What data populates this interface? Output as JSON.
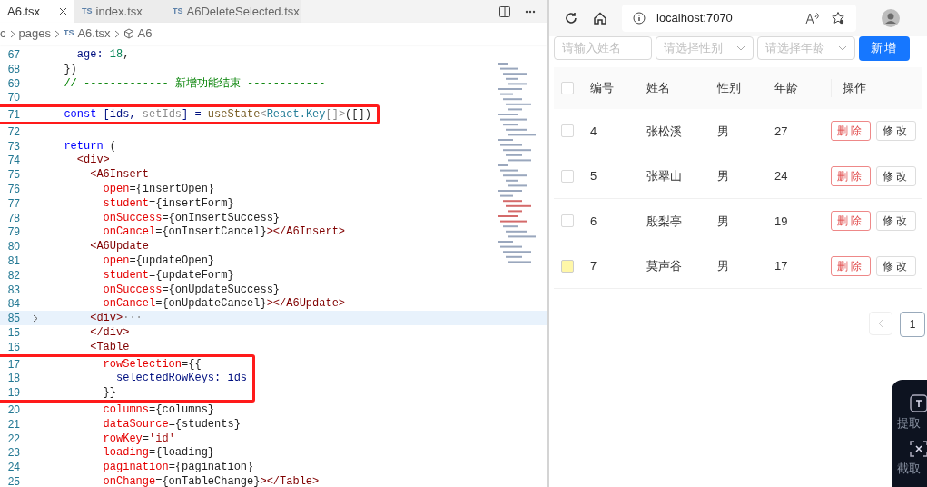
{
  "editor": {
    "tabs": [
      {
        "label": "A6.tsx",
        "selected": true
      },
      {
        "badge": "TS",
        "label": "index.tsx",
        "selected": false
      },
      {
        "badge": "TS",
        "label": "A6DeleteSelected.tsx",
        "selected": false
      }
    ],
    "breadcrumb": [
      {
        "kind": "text",
        "text": "c"
      },
      {
        "kind": "text",
        "text": "pages"
      },
      {
        "kind": "file",
        "badge": "TS",
        "text": "A6.tsx"
      },
      {
        "kind": "symbol",
        "text": "A6"
      }
    ],
    "lines": [
      {
        "num": "67",
        "boxed": false,
        "current": false,
        "folded": false,
        "tokens": [
          {
            "kind": "var",
            "text": "    age: "
          },
          {
            "kind": "num",
            "text": "18"
          },
          {
            "kind": "plain",
            "text": ","
          }
        ]
      },
      {
        "num": "68",
        "boxed": false,
        "current": false,
        "folded": false,
        "tokens": [
          {
            "kind": "plain",
            "text": "  })"
          }
        ]
      },
      {
        "num": "69",
        "boxed": false,
        "current": false,
        "folded": false,
        "tokens": [
          {
            "kind": "comment",
            "text": "  // ------------- 新增功能结束 ------------"
          }
        ]
      },
      {
        "num": "70",
        "boxed": false,
        "current": false,
        "folded": false
      },
      {
        "num": "71",
        "boxed": true,
        "current": false,
        "folded": false,
        "tokens": [
          {
            "kind": "kw",
            "text": "  const "
          },
          {
            "kind": "var",
            "text": "[ids, "
          },
          {
            "kind": "fade",
            "text": "setIds"
          },
          {
            "kind": "var",
            "text": "] = "
          },
          {
            "kind": "fn",
            "text": "useState"
          },
          {
            "kind": "fade",
            "text": "<"
          },
          {
            "kind": "type",
            "text": "React.Key"
          },
          {
            "kind": "fade",
            "text": "[]>"
          },
          {
            "kind": "plain",
            "text": "([])"
          }
        ]
      },
      {
        "num": "72",
        "boxed": false,
        "current": false,
        "folded": false
      },
      {
        "num": "73",
        "boxed": false,
        "current": false,
        "folded": false,
        "tokens": [
          {
            "kind": "kw",
            "text": "  return "
          },
          {
            "kind": "plain",
            "text": "("
          }
        ]
      },
      {
        "num": "74",
        "boxed": false,
        "current": false,
        "folded": false,
        "tokens": [
          {
            "kind": "tag",
            "text": "    <div>"
          }
        ]
      },
      {
        "num": "75",
        "boxed": false,
        "current": false,
        "folded": false,
        "tokens": [
          {
            "kind": "tag",
            "text": "      <A6Insert"
          }
        ]
      },
      {
        "num": "76",
        "boxed": false,
        "current": false,
        "folded": false,
        "tokens": [
          {
            "kind": "attr",
            "text": "        open"
          },
          {
            "kind": "plain",
            "text": "={insertOpen}"
          }
        ]
      },
      {
        "num": "77",
        "boxed": false,
        "current": false,
        "folded": false,
        "tokens": [
          {
            "kind": "attr",
            "text": "        student"
          },
          {
            "kind": "plain",
            "text": "={insertForm}"
          }
        ]
      },
      {
        "num": "78",
        "boxed": false,
        "current": false,
        "folded": false,
        "tokens": [
          {
            "kind": "attr",
            "text": "        onSuccess"
          },
          {
            "kind": "plain",
            "text": "={onInsertSuccess}"
          }
        ]
      },
      {
        "num": "79",
        "boxed": false,
        "current": false,
        "folded": false,
        "tokens": [
          {
            "kind": "attr",
            "text": "        onCancel"
          },
          {
            "kind": "plain",
            "text": "={onInsertCancel}"
          },
          {
            "kind": "tag",
            "text": "></A6Insert>"
          }
        ]
      },
      {
        "num": "80",
        "boxed": false,
        "current": false,
        "folded": false,
        "tokens": [
          {
            "kind": "tag",
            "text": "      <A6Update"
          }
        ]
      },
      {
        "num": "81",
        "boxed": false,
        "current": false,
        "folded": false,
        "tokens": [
          {
            "kind": "attr",
            "text": "        open"
          },
          {
            "kind": "plain",
            "text": "={updateOpen}"
          }
        ]
      },
      {
        "num": "82",
        "boxed": false,
        "current": false,
        "folded": false,
        "tokens": [
          {
            "kind": "attr",
            "text": "        student"
          },
          {
            "kind": "plain",
            "text": "={updateForm}"
          }
        ]
      },
      {
        "num": "83",
        "boxed": false,
        "current": false,
        "folded": false,
        "tokens": [
          {
            "kind": "attr",
            "text": "        onSuccess"
          },
          {
            "kind": "plain",
            "text": "={onUpdateSuccess}"
          }
        ]
      },
      {
        "num": "84",
        "boxed": false,
        "current": false,
        "folded": false,
        "tokens": [
          {
            "kind": "attr",
            "text": "        onCancel"
          },
          {
            "kind": "plain",
            "text": "={onUpdateCancel}"
          },
          {
            "kind": "tag",
            "text": "></A6Update>"
          }
        ]
      },
      {
        "num": "85",
        "boxed": false,
        "current": true,
        "folded": true,
        "tokens": [
          {
            "kind": "tag",
            "text": "      <div>"
          },
          {
            "kind": "fade",
            "text": "···"
          }
        ]
      },
      {
        "num": "15",
        "boxed": false,
        "current": false,
        "folded": false,
        "tokens": [
          {
            "kind": "tag",
            "text": "      </div>"
          }
        ]
      },
      {
        "num": "16",
        "boxed": false,
        "current": false,
        "folded": false,
        "tokens": [
          {
            "kind": "tag",
            "text": "      <Table"
          }
        ]
      },
      {
        "num": "17",
        "boxed": true,
        "current": false,
        "folded": false,
        "tokens": [
          {
            "kind": "attr",
            "text": "        rowSelection"
          },
          {
            "kind": "plain",
            "text": "={{"
          }
        ]
      },
      {
        "num": "18",
        "boxed": true,
        "current": false,
        "folded": false,
        "tokens": [
          {
            "kind": "var",
            "text": "          selectedRowKeys: ids"
          }
        ]
      },
      {
        "num": "19",
        "boxed": true,
        "current": false,
        "folded": false,
        "tokens": [
          {
            "kind": "plain",
            "text": "        }}"
          }
        ]
      },
      {
        "num": "20",
        "boxed": false,
        "current": false,
        "folded": false,
        "tokens": [
          {
            "kind": "attr",
            "text": "        columns"
          },
          {
            "kind": "plain",
            "text": "={columns}"
          }
        ]
      },
      {
        "num": "21",
        "boxed": false,
        "current": false,
        "folded": false,
        "tokens": [
          {
            "kind": "attr",
            "text": "        dataSource"
          },
          {
            "kind": "plain",
            "text": "={students}"
          }
        ]
      },
      {
        "num": "22",
        "boxed": false,
        "current": false,
        "folded": false,
        "tokens": [
          {
            "kind": "attr",
            "text": "        rowKey"
          },
          {
            "kind": "plain",
            "text": "="
          },
          {
            "kind": "str",
            "text": "'id'"
          }
        ]
      },
      {
        "num": "23",
        "boxed": false,
        "current": false,
        "folded": false,
        "tokens": [
          {
            "kind": "attr",
            "text": "        loading"
          },
          {
            "kind": "plain",
            "text": "={loading}"
          }
        ]
      },
      {
        "num": "24",
        "boxed": false,
        "current": false,
        "folded": false,
        "tokens": [
          {
            "kind": "attr",
            "text": "        pagination"
          },
          {
            "kind": "plain",
            "text": "={pagination}"
          }
        ]
      },
      {
        "num": "25",
        "boxed": false,
        "current": false,
        "folded": false,
        "tokens": [
          {
            "kind": "attr",
            "text": "        onChange"
          },
          {
            "kind": "plain",
            "text": "={onTableChange}"
          },
          {
            "kind": "tag",
            "text": "></Table>"
          }
        ]
      }
    ]
  },
  "browser": {
    "address": "localhost:7070",
    "filters": [
      {
        "kind": "input",
        "placeholder": "请输入姓名"
      },
      {
        "kind": "select",
        "placeholder": "请选择性别"
      },
      {
        "kind": "select",
        "placeholder": "请选择年龄"
      }
    ],
    "add_button": "新增",
    "table": {
      "columns": [
        "编号",
        "姓名",
        "性别",
        "年龄",
        "操作"
      ],
      "header_checked": false,
      "rows": [
        {
          "id": "4",
          "name": "张松溪",
          "gender": "男",
          "age": "27",
          "checked": false,
          "hovered": false,
          "actions": [
            "删除",
            "修改"
          ]
        },
        {
          "id": "5",
          "name": "张翠山",
          "gender": "男",
          "age": "24",
          "checked": false,
          "hovered": false,
          "actions": [
            "删除",
            "修改"
          ]
        },
        {
          "id": "6",
          "name": "殷梨亭",
          "gender": "男",
          "age": "19",
          "checked": false,
          "hovered": false,
          "actions": [
            "删除",
            "修改"
          ]
        },
        {
          "id": "7",
          "name": "莫声谷",
          "gender": "男",
          "age": "17",
          "checked": false,
          "hovered": true,
          "actions": [
            "删除",
            "修改"
          ]
        }
      ]
    },
    "pagination": {
      "prev_disabled": true,
      "pages": [
        {
          "label": "1",
          "selected": true
        }
      ]
    },
    "overlay": {
      "items": [
        {
          "kind": "text-extract",
          "label": "提取"
        },
        {
          "kind": "screen-capture",
          "label": "截取"
        }
      ]
    }
  }
}
